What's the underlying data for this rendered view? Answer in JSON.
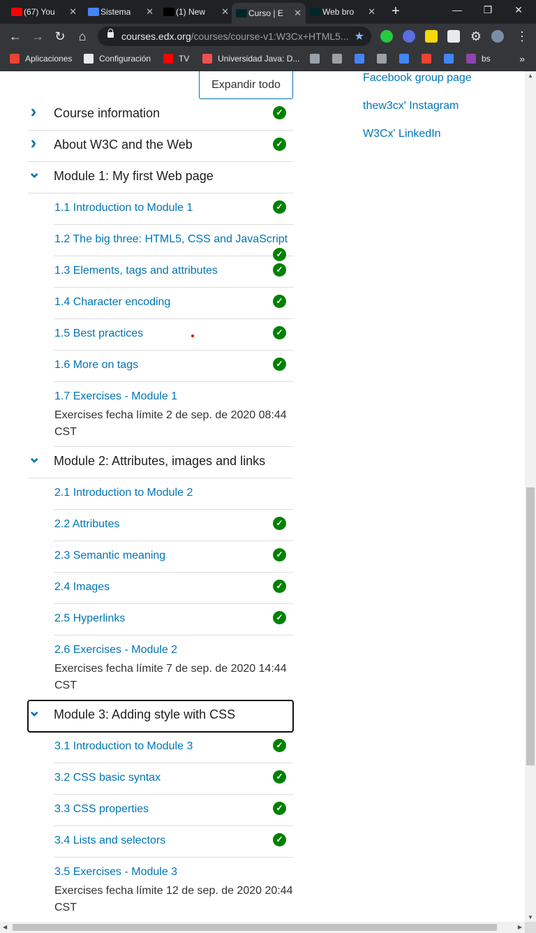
{
  "browser": {
    "tabs": [
      {
        "title": "(67) You",
        "favicon_color": "#ff0000"
      },
      {
        "title": "Sistema",
        "favicon_color": "#4285f4"
      },
      {
        "title": "(1) New",
        "favicon_color": "#000000"
      },
      {
        "title": "Curso | E",
        "favicon_color": "#02262b",
        "active": true
      },
      {
        "title": "Web bro",
        "favicon_color": "#02262b"
      }
    ],
    "new_tab": "+",
    "window_controls": {
      "minimize": "—",
      "restore": "❐",
      "close": "✕"
    },
    "url_host": "courses.edx.org",
    "url_path": "/courses/course-v1:W3Cx+HTML5...",
    "bookmarks": [
      {
        "label": "Aplicaciones",
        "icon": "apps-grid-icon"
      },
      {
        "label": "Configuración",
        "icon": "gear-icon"
      },
      {
        "label": "TV",
        "icon": "youtube-icon"
      },
      {
        "label": "Universidad Java: D...",
        "icon": "udemy-icon"
      },
      {
        "label": "",
        "icon": "app-icon"
      },
      {
        "label": "",
        "icon": "app-icon"
      },
      {
        "label": "",
        "icon": "docs-icon"
      },
      {
        "label": "",
        "icon": "app-icon"
      },
      {
        "label": "",
        "icon": "contacts-icon"
      },
      {
        "label": "",
        "icon": "gmail-icon"
      },
      {
        "label": "",
        "icon": "calendar-icon"
      },
      {
        "label": "bs",
        "icon": "bs-icon"
      }
    ],
    "bookmarks_overflow": "»"
  },
  "page": {
    "expand_all_label": "Expandir todo",
    "side_links": [
      "Facebook group page",
      "thew3cx' Instagram",
      "W3Cx' LinkedIn"
    ],
    "check_glyph": "✓",
    "outline": [
      {
        "type": "section",
        "title": "Course information",
        "expanded": false,
        "completed": true
      },
      {
        "type": "section",
        "title": "About W3C and the Web",
        "expanded": false,
        "completed": true
      },
      {
        "type": "section",
        "title": "Module 1: My first Web page",
        "expanded": true,
        "completed": false
      },
      {
        "type": "sub",
        "title": "1.1 Introduction to Module 1",
        "completed": true
      },
      {
        "type": "sub",
        "title": "1.2 The big three: HTML5, CSS and JavaScript",
        "completed": true
      },
      {
        "type": "sub",
        "title": "1.3 Elements, tags and attributes",
        "completed": true
      },
      {
        "type": "sub",
        "title": "1.4 Character encoding",
        "completed": true
      },
      {
        "type": "sub",
        "title": "1.5 Best practices",
        "completed": true
      },
      {
        "type": "sub",
        "title": "1.6 More on tags",
        "completed": true
      },
      {
        "type": "sub",
        "title": "1.7 Exercises - Module 1",
        "completed": false,
        "due": "Exercises fecha límite 2 de sep. de 2020 08:44 CST"
      },
      {
        "type": "section",
        "title": "Module 2: Attributes, images and links",
        "expanded": true,
        "completed": false
      },
      {
        "type": "sub",
        "title": "2.1 Introduction to Module 2",
        "completed": false
      },
      {
        "type": "sub",
        "title": "2.2 Attributes",
        "completed": true
      },
      {
        "type": "sub",
        "title": "2.3 Semantic meaning",
        "completed": true
      },
      {
        "type": "sub",
        "title": "2.4 Images",
        "completed": true
      },
      {
        "type": "sub",
        "title": "2.5 Hyperlinks",
        "completed": true
      },
      {
        "type": "sub",
        "title": "2.6 Exercises - Module 2",
        "completed": false,
        "due": "Exercises fecha límite 7 de sep. de 2020 14:44 CST"
      },
      {
        "type": "section",
        "title": "Module 3: Adding style with CSS",
        "expanded": true,
        "completed": false,
        "focused": true
      },
      {
        "type": "sub",
        "title": "3.1 Introduction to Module 3",
        "completed": true
      },
      {
        "type": "sub",
        "title": "3.2 CSS basic syntax",
        "completed": true
      },
      {
        "type": "sub",
        "title": "3.3 CSS properties",
        "completed": true
      },
      {
        "type": "sub",
        "title": "3.4 Lists and selectors",
        "completed": true
      },
      {
        "type": "sub",
        "title": "3.5 Exercises - Module 3",
        "completed": false,
        "due": "Exercises fecha límite 12 de sep. de 2020 20:44 CST"
      }
    ]
  }
}
